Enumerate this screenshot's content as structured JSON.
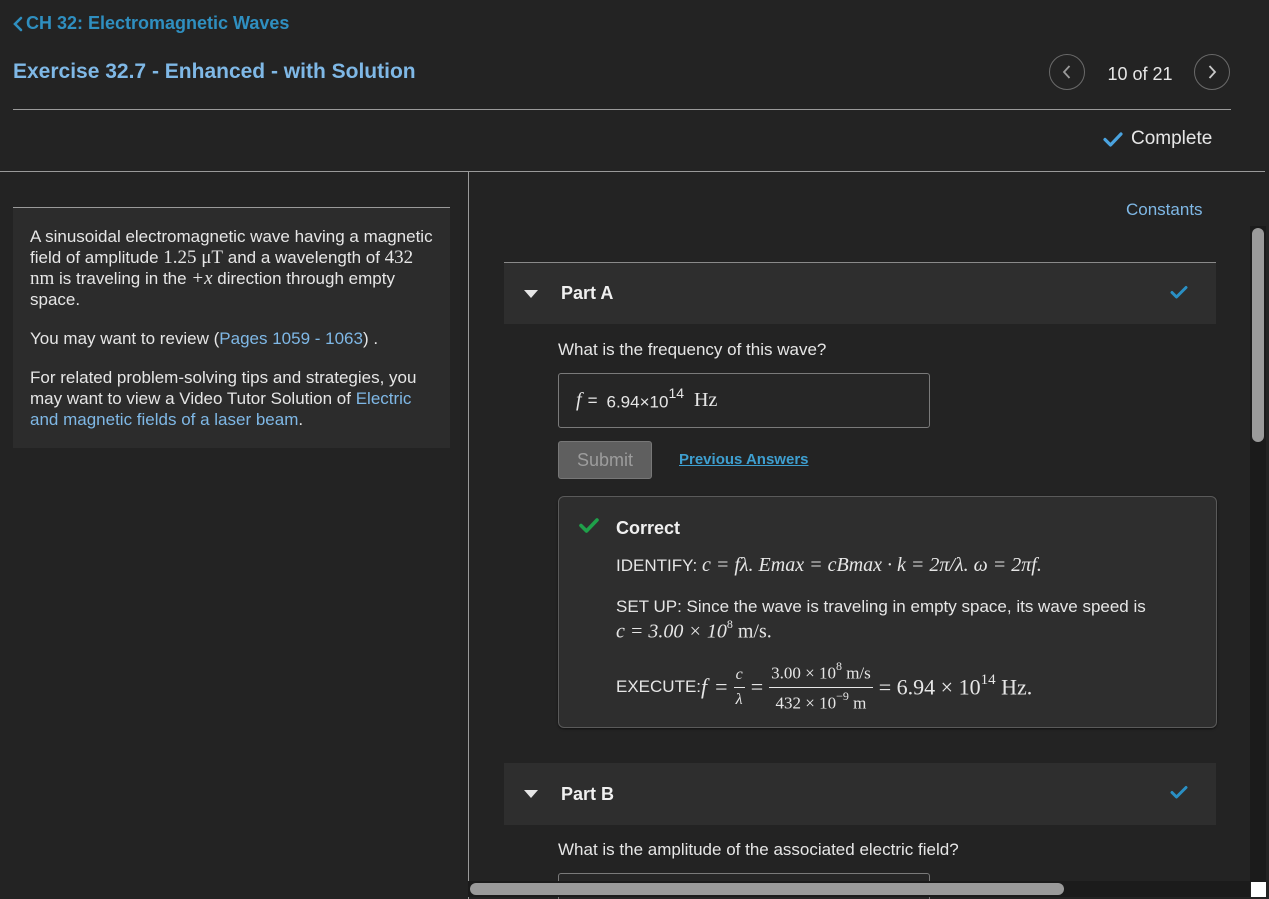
{
  "breadcrumb": {
    "label": "CH 32: Electromagnetic Waves"
  },
  "header": {
    "title": "Exercise 32.7 - Enhanced - with Solution",
    "pager": "10 of 21",
    "status": "Complete"
  },
  "intro": {
    "p1_a": "A sinusoidal electromagnetic wave having a magnetic field of amplitude ",
    "p1_b": "1.25 μT",
    "p1_c": " and a wavelength of ",
    "p1_d": "432 nm",
    "p1_e": " is traveling in the ",
    "p1_f": "+x",
    "p1_g": " direction through empty space.",
    "p2_a": "You may want to review (",
    "p2_link": "Pages 1059 - 1063",
    "p2_b": ") .",
    "p3_a": "For related problem-solving tips and strategies, you may want to view a Video Tutor Solution of ",
    "p3_link": "Electric and magnetic fields of a laser beam",
    "p3_b": "."
  },
  "constants_link": "Constants",
  "partA": {
    "label": "Part A",
    "question": "What is the frequency of this wave?",
    "answer_var": "f",
    "answer_eq": "=",
    "answer_mantissa": "6.94×10",
    "answer_exp": "14",
    "answer_unit": "Hz",
    "submit_label": "Submit",
    "previous_answers_label": "Previous Answers",
    "feedback": {
      "title": "Correct",
      "identify_label": "IDENTIFY: ",
      "identify_math": "c = fλ. Emax = cBmax · k = 2π/λ. ω = 2πf.",
      "setup_text": "SET UP: Since the wave is traveling in empty space, its wave speed is",
      "setup_math": "c = 3.00 × 10",
      "setup_exp": "8",
      "setup_unit": " m/s.",
      "execute_label": "EXECUTE: ",
      "exec_f": "f",
      "exec_frac1_num": "c",
      "exec_frac1_den": "λ",
      "exec_frac2_num": "3.00 × 10",
      "exec_frac2_num_exp": "8",
      "exec_frac2_num_unit": " m/s",
      "exec_frac2_den": "432 × 10",
      "exec_frac2_den_exp": "−9",
      "exec_frac2_den_unit": " m",
      "exec_result": "= 6.94 × 10",
      "exec_result_exp": "14",
      "exec_result_unit": " Hz."
    }
  },
  "partB": {
    "label": "Part B",
    "question": "What is the amplitude of the associated electric field?"
  },
  "colors": {
    "background": "#232323",
    "link": "#7fb8e6",
    "breadcrumb": "#2f8fc0",
    "correct_green": "#1fa04a",
    "part_check_blue": "#2a8fc4"
  }
}
